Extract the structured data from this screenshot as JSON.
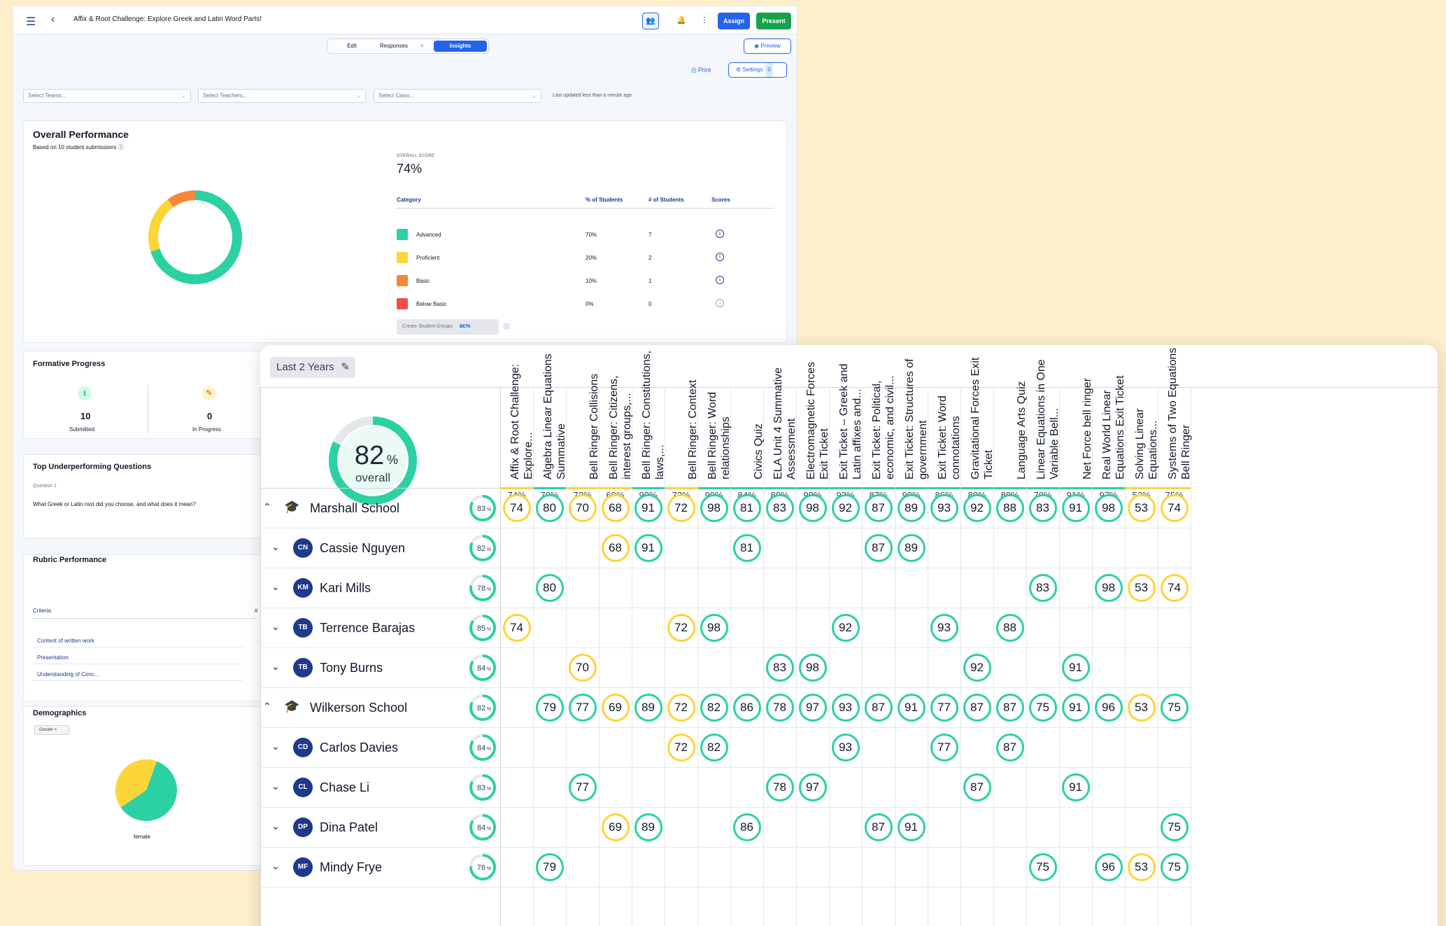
{
  "back": {
    "title": "Affix & Root Challenge: Explore Greek and Latin Word Parts!",
    "assign": "Assign",
    "present": "Present",
    "tabs": [
      "Edit",
      "Responses",
      "Insights"
    ],
    "tab_close": "×",
    "preview": "Preview",
    "print": "Print",
    "settings": "Settings",
    "settings_count": "0",
    "selects": [
      "Select Teams...",
      "Select Teachers...",
      "Select Class..."
    ],
    "updated": "Last updated less than a minute ago",
    "overall_performance": {
      "title": "Overall Performance",
      "subtitle": "Based on 10 student submissions",
      "score_label": "OVERALL SCORE",
      "score": "74%",
      "headers": [
        "Category",
        "% of Students",
        "# of Students",
        "Scores"
      ],
      "rows": [
        {
          "name": "Advanced",
          "pct": "70%",
          "count": "7",
          "color": "#2bd1a2",
          "value": 70
        },
        {
          "name": "Proficient",
          "pct": "20%",
          "count": "2",
          "color": "#fcd53b",
          "value": 20
        },
        {
          "name": "Basic",
          "pct": "10%",
          "count": "1",
          "color": "#f5883a",
          "value": 10
        },
        {
          "name": "Below Basic",
          "pct": "0%",
          "count": "0",
          "color": "#f34b50",
          "value": 0
        }
      ],
      "groups_button": "Create Student Groups",
      "beta": "BETA"
    },
    "formative": {
      "title": "Formative Progress",
      "submitted_value": "10",
      "submitted_label": "Submitted",
      "progress_value": "0",
      "progress_label": "In Progress"
    },
    "underperforming": {
      "title": "Top Underperforming Questions",
      "question_label": "Question 1",
      "question_text": "What Greek or Latin root did you choose, and what does it mean?"
    },
    "rubric": {
      "title": "Rubric Performance",
      "criteria_label": "Criteria",
      "col_mark": "#",
      "items": [
        "Content of written work",
        "Presentation",
        "Understanding of Conc..."
      ]
    },
    "demographics": {
      "title": "Demographics",
      "chip": "Gender",
      "chip_x": "×",
      "label": "female",
      "slices": [
        {
          "color": "#2bd1a2",
          "value": 60
        },
        {
          "color": "#fcd53b",
          "value": 40
        }
      ]
    }
  },
  "front": {
    "range": "Last 2 Years",
    "overall_value": "82",
    "overall_unit": "%",
    "overall_label": "overall",
    "overall_fraction": 0.82,
    "columns": [
      {
        "label": "Affix & Root Challenge: Explore...",
        "pct": "74%",
        "level": "y"
      },
      {
        "label": "Algebra Linear Equations Summative",
        "pct": "79%",
        "level": "g"
      },
      {
        "label": "Bell Ringer Collisions",
        "pct": "73%",
        "level": "y"
      },
      {
        "label": "Bell Ringer: Citizens, interest groups,...",
        "pct": "69%",
        "level": "y"
      },
      {
        "label": "Bell Ringer: Constitutions, laws,...",
        "pct": "90%",
        "level": "g"
      },
      {
        "label": "Bell Ringer: Context",
        "pct": "72%",
        "level": "y"
      },
      {
        "label": "Bell Ringer: Word relationships",
        "pct": "90%",
        "level": "g"
      },
      {
        "label": "Civics Quiz",
        "pct": "84%",
        "level": "g"
      },
      {
        "label": "ELA Unit 4 Summative Assessment",
        "pct": "80%",
        "level": "g"
      },
      {
        "label": "Electromagnetic Forces Exit Ticket",
        "pct": "98%",
        "level": "g"
      },
      {
        "label": "Exit Ticket – Greek and Latin affixes and...",
        "pct": "93%",
        "level": "g"
      },
      {
        "label": "Exit Ticket: Political, economic, and civil...",
        "pct": "87%",
        "level": "g"
      },
      {
        "label": "Exit Ticket: Structures of government",
        "pct": "90%",
        "level": "g"
      },
      {
        "label": "Exit Ticket: Word connotations",
        "pct": "86%",
        "level": "g"
      },
      {
        "label": "Gravitational Forces Exit Ticket",
        "pct": "89%",
        "level": "g"
      },
      {
        "label": "Language Arts Quiz",
        "pct": "88%",
        "level": "g"
      },
      {
        "label": "Linear Equations in One Variable Bell...",
        "pct": "79%",
        "level": "g"
      },
      {
        "label": "Net Force bell ringer",
        "pct": "91%",
        "level": "g"
      },
      {
        "label": "Real World Linear Equations Exit Ticket",
        "pct": "97%",
        "level": "g"
      },
      {
        "label": "Solving Linear Equations...",
        "pct": "53%",
        "level": "y"
      },
      {
        "label": "Systems of Two Equations Bell Ringer",
        "pct": "75%",
        "level": "y"
      }
    ],
    "rows": [
      {
        "type": "school",
        "name": "Marshall School",
        "avg": "83",
        "chev": "⌃",
        "scores": [
          74,
          80,
          70,
          68,
          91,
          72,
          98,
          81,
          83,
          98,
          92,
          87,
          89,
          93,
          92,
          88,
          83,
          91,
          98,
          53,
          74
        ]
      },
      {
        "type": "student",
        "initials": "CN",
        "name": "Cassie Nguyen",
        "avg": "82",
        "chev": "⌄",
        "scores": [
          null,
          null,
          null,
          68,
          91,
          null,
          null,
          81,
          null,
          null,
          null,
          87,
          89,
          null,
          null,
          null,
          null,
          null,
          null,
          null,
          null
        ]
      },
      {
        "type": "student",
        "initials": "KM",
        "name": "Kari Mills",
        "avg": "78",
        "chev": "⌄",
        "scores": [
          null,
          80,
          null,
          null,
          null,
          null,
          null,
          null,
          null,
          null,
          null,
          null,
          null,
          null,
          null,
          null,
          83,
          null,
          98,
          53,
          74
        ]
      },
      {
        "type": "student",
        "initials": "TB",
        "name": "Terrence Barajas",
        "avg": "85",
        "chev": "⌄",
        "scores": [
          74,
          null,
          null,
          null,
          null,
          72,
          98,
          null,
          null,
          null,
          92,
          null,
          null,
          93,
          null,
          88,
          null,
          null,
          null,
          null,
          null
        ]
      },
      {
        "type": "student",
        "initials": "TB",
        "name": "Tony Burns",
        "avg": "84",
        "chev": "⌄",
        "scores": [
          null,
          null,
          70,
          null,
          null,
          null,
          null,
          null,
          83,
          98,
          null,
          null,
          null,
          null,
          92,
          null,
          null,
          91,
          null,
          null,
          null
        ]
      },
      {
        "type": "school",
        "name": "Wilkerson School",
        "avg": "82",
        "chev": "⌃",
        "scores": [
          null,
          79,
          77,
          69,
          89,
          72,
          82,
          86,
          78,
          97,
          93,
          87,
          91,
          77,
          87,
          87,
          75,
          91,
          96,
          53,
          75
        ]
      },
      {
        "type": "student",
        "initials": "CD",
        "name": "Carlos Davies",
        "avg": "84",
        "chev": "⌄",
        "scores": [
          null,
          null,
          null,
          null,
          null,
          72,
          82,
          null,
          null,
          null,
          93,
          null,
          null,
          77,
          null,
          87,
          null,
          null,
          null,
          null,
          null
        ]
      },
      {
        "type": "student",
        "initials": "CL",
        "name": "Chase Li",
        "avg": "83",
        "chev": "⌄",
        "scores": [
          null,
          null,
          77,
          null,
          null,
          null,
          null,
          null,
          78,
          97,
          null,
          null,
          null,
          null,
          87,
          null,
          null,
          91,
          null,
          null,
          null
        ]
      },
      {
        "type": "student",
        "initials": "DP",
        "name": "Dina Patel",
        "avg": "84",
        "chev": "⌄",
        "scores": [
          null,
          null,
          null,
          69,
          89,
          null,
          null,
          86,
          null,
          null,
          null,
          87,
          91,
          null,
          null,
          null,
          null,
          null,
          null,
          null,
          75
        ]
      },
      {
        "type": "student",
        "initials": "MF",
        "name": "Mindy Frye",
        "avg": "76",
        "chev": "⌄",
        "scores": [
          null,
          79,
          null,
          null,
          null,
          null,
          null,
          null,
          null,
          null,
          null,
          null,
          null,
          null,
          null,
          null,
          75,
          null,
          96,
          53,
          75
        ]
      }
    ],
    "threshold": 75
  }
}
